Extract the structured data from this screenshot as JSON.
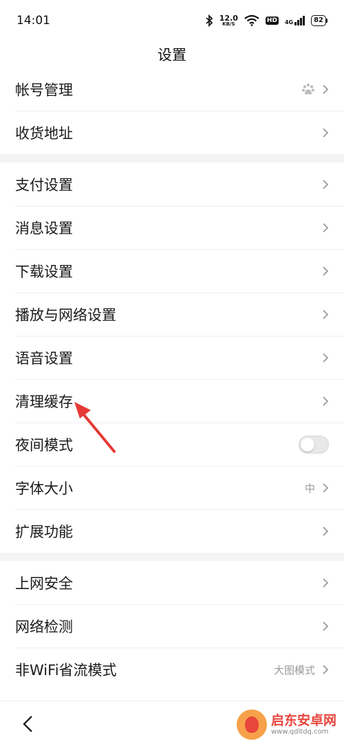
{
  "status_bar": {
    "time": "14:01",
    "net_speed_value": "12.0",
    "net_speed_unit": "KB/S",
    "hd_label": "HD",
    "network_type": "4G",
    "battery_level": "82",
    "icons": [
      "bluetooth-icon",
      "wifi-icon",
      "signal-icon",
      "battery-icon"
    ]
  },
  "header": {
    "title": "设置"
  },
  "groups": [
    {
      "items": [
        {
          "label": "帐号管理",
          "type": "link",
          "extra_icon": "baidu-paw-icon"
        },
        {
          "label": "收货地址",
          "type": "link"
        }
      ]
    },
    {
      "items": [
        {
          "label": "支付设置",
          "type": "link"
        },
        {
          "label": "消息设置",
          "type": "link"
        },
        {
          "label": "下载设置",
          "type": "link"
        },
        {
          "label": "播放与网络设置",
          "type": "link"
        },
        {
          "label": "语音设置",
          "type": "link"
        },
        {
          "label": "清理缓存",
          "type": "link"
        },
        {
          "label": "夜间模式",
          "type": "toggle",
          "on": false
        },
        {
          "label": "字体大小",
          "type": "link",
          "value": "中"
        },
        {
          "label": "扩展功能",
          "type": "link"
        }
      ]
    },
    {
      "items": [
        {
          "label": "上网安全",
          "type": "link"
        },
        {
          "label": "网络检测",
          "type": "link"
        },
        {
          "label": "非WiFi省流模式",
          "type": "link",
          "value": "大图模式"
        }
      ]
    }
  ],
  "annotation": {
    "color": "#e53935",
    "target": "清理缓存"
  },
  "nav": {
    "back_icon": "chevron-left-icon"
  },
  "watermark": {
    "main": "启东安卓网",
    "sub": "www.qdltdq.com"
  },
  "colors": {
    "separator": "#f4f4f4",
    "chevron": "#9a9a9a",
    "accent_red": "#e53935"
  }
}
